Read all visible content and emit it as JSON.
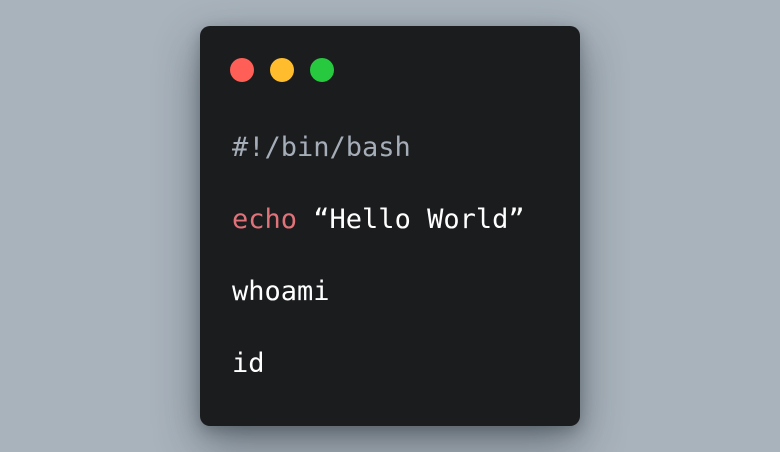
{
  "window": {
    "controls": [
      {
        "name": "close",
        "color": "#ff5f56"
      },
      {
        "name": "minimize",
        "color": "#ffbd2e"
      },
      {
        "name": "maximize",
        "color": "#27c93f"
      }
    ]
  },
  "code": {
    "lines": [
      {
        "tokens": [
          {
            "text": "#!/bin/bash",
            "kind": "comment"
          }
        ]
      },
      {
        "tokens": [
          {
            "text": "echo",
            "kind": "keyword"
          },
          {
            "text": " “Hello World”",
            "kind": "plain"
          }
        ]
      },
      {
        "tokens": [
          {
            "text": "whoami",
            "kind": "plain"
          }
        ]
      },
      {
        "tokens": [
          {
            "text": "id",
            "kind": "plain"
          }
        ]
      }
    ]
  }
}
